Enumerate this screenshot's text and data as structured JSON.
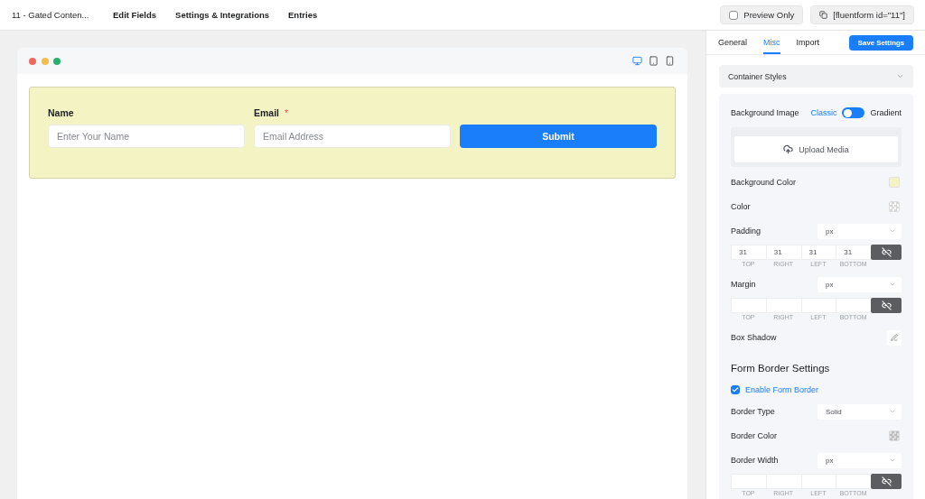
{
  "top_bar": {
    "form_title": "11 - Gated Conten...",
    "nav": [
      {
        "label": "Edit Fields",
        "selected": false
      },
      {
        "label": "Settings & Integrations",
        "selected": false
      },
      {
        "label": "Entries",
        "selected": false
      }
    ],
    "preview_toggle": {
      "label": "Preview Only",
      "checked": false
    },
    "shortcode": "[fluentform id=\"11\"]"
  },
  "preview": {
    "devices": [
      {
        "kind": "desktop",
        "selected": true
      },
      {
        "kind": "tablet",
        "selected": false
      },
      {
        "kind": "mobile",
        "selected": false
      }
    ],
    "form": {
      "fields": [
        {
          "label": "Name",
          "placeholder": "Enter Your Name"
        },
        {
          "label": "Email",
          "required_mark": "*",
          "placeholder": "Email Address"
        }
      ],
      "submit": "Submit"
    }
  },
  "settings": {
    "tabs": [
      {
        "label": "General",
        "selected": false
      },
      {
        "label": "Misc",
        "selected": true
      },
      {
        "label": "Import",
        "selected": false
      }
    ],
    "save_button": "Save Settings",
    "section": {
      "title": "Container Styles",
      "expanded": true,
      "controls": [
        {
          "kind": "switch",
          "label": "Background Image",
          "options": [
            {
              "label": "Classic",
              "selected": true
            },
            {
              "label": "Gradient",
              "selected": false
            }
          ]
        },
        {
          "kind": "upload",
          "label": "Upload Media"
        },
        {
          "kind": "color",
          "label": "Background Color",
          "color": "#f3f3c4"
        },
        {
          "kind": "color",
          "label": "Color"
        },
        {
          "kind": "spacing",
          "label": "Padding",
          "unit": "px",
          "sides": [
            {
              "value": "31",
              "caption": "TOP"
            },
            {
              "value": "31",
              "caption": "RIGHT"
            },
            {
              "value": "31",
              "caption": "LEFT"
            },
            {
              "value": "31",
              "caption": "BOTTOM"
            }
          ]
        },
        {
          "kind": "spacing",
          "label": "Margin",
          "unit": "px",
          "sides": [
            {
              "caption": "TOP"
            },
            {
              "caption": "RIGHT"
            },
            {
              "caption": "LEFT"
            },
            {
              "caption": "BOTTOM"
            }
          ]
        },
        {
          "kind": "shadow",
          "label": "Box Shadow"
        },
        {
          "kind": "heading",
          "label": "Form Border Settings"
        },
        {
          "kind": "checkbox",
          "label": "Enable Form Border",
          "checked": true
        },
        {
          "kind": "select",
          "label": "Border Type",
          "value": "Solid"
        },
        {
          "kind": "color",
          "label": "Border Color"
        },
        {
          "kind": "spacing",
          "label": "Border Width",
          "unit": "px",
          "sides": [
            {
              "caption": "TOP"
            },
            {
              "caption": "RIGHT"
            },
            {
              "caption": "LEFT"
            },
            {
              "caption": "BOTTOM"
            }
          ]
        }
      ]
    }
  }
}
